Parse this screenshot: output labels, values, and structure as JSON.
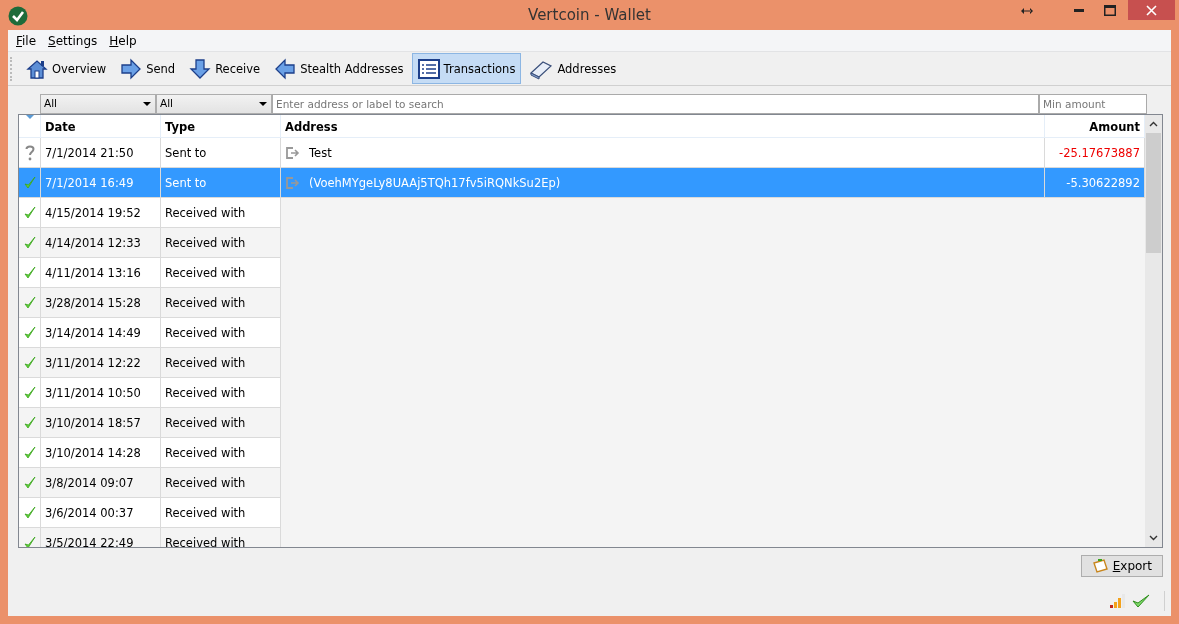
{
  "window": {
    "title": "Vertcoin - Wallet"
  },
  "menu": [
    "File",
    "Settings",
    "Help"
  ],
  "toolbar": [
    {
      "label": "Overview",
      "kind": "overview",
      "selected": false
    },
    {
      "label": "Send",
      "kind": "send",
      "selected": false
    },
    {
      "label": "Receive",
      "kind": "receive",
      "selected": false
    },
    {
      "label": "Stealth Addresses",
      "kind": "stealth",
      "selected": false
    },
    {
      "label": "Transactions",
      "kind": "transactions",
      "selected": true
    },
    {
      "label": "Addresses",
      "kind": "addresses",
      "selected": false
    }
  ],
  "filters": {
    "date": "All",
    "type": "All",
    "search_placeholder": "Enter address or label to search",
    "amount_placeholder": "Min amount"
  },
  "table": {
    "columns": [
      "Date",
      "Type",
      "Address",
      "Amount"
    ],
    "rows": [
      {
        "confirmed": false,
        "date": "7/1/2014 21:50",
        "type": "Sent to",
        "address": "Test",
        "amount": "-25.17673887",
        "selected": false
      },
      {
        "confirmed": true,
        "date": "7/1/2014 16:49",
        "type": "Sent to",
        "address": "(VoehMYgeLy8UAAj5TQh17fv5iRQNkSu2Ep)",
        "amount": "-5.30622892",
        "selected": true
      },
      {
        "confirmed": true,
        "date": "4/15/2014 19:52",
        "type": "Received with",
        "selected": false
      },
      {
        "confirmed": true,
        "date": "4/14/2014 12:33",
        "type": "Received with",
        "selected": false
      },
      {
        "confirmed": true,
        "date": "4/11/2014 13:16",
        "type": "Received with",
        "selected": false
      },
      {
        "confirmed": true,
        "date": "3/28/2014 15:28",
        "type": "Received with",
        "selected": false
      },
      {
        "confirmed": true,
        "date": "3/14/2014 14:49",
        "type": "Received with",
        "selected": false
      },
      {
        "confirmed": true,
        "date": "3/11/2014 12:22",
        "type": "Received with",
        "selected": false
      },
      {
        "confirmed": true,
        "date": "3/11/2014 10:50",
        "type": "Received with",
        "selected": false
      },
      {
        "confirmed": true,
        "date": "3/10/2014 18:57",
        "type": "Received with",
        "selected": false
      },
      {
        "confirmed": true,
        "date": "3/10/2014 14:28",
        "type": "Received with",
        "selected": false
      },
      {
        "confirmed": true,
        "date": "3/8/2014 09:07",
        "type": "Received with",
        "selected": false
      },
      {
        "confirmed": true,
        "date": "3/6/2014 00:37",
        "type": "Received with",
        "selected": false
      },
      {
        "confirmed": true,
        "date": "3/5/2014 22:49",
        "type": "Received with",
        "selected": false
      }
    ]
  },
  "export_button": "Export"
}
